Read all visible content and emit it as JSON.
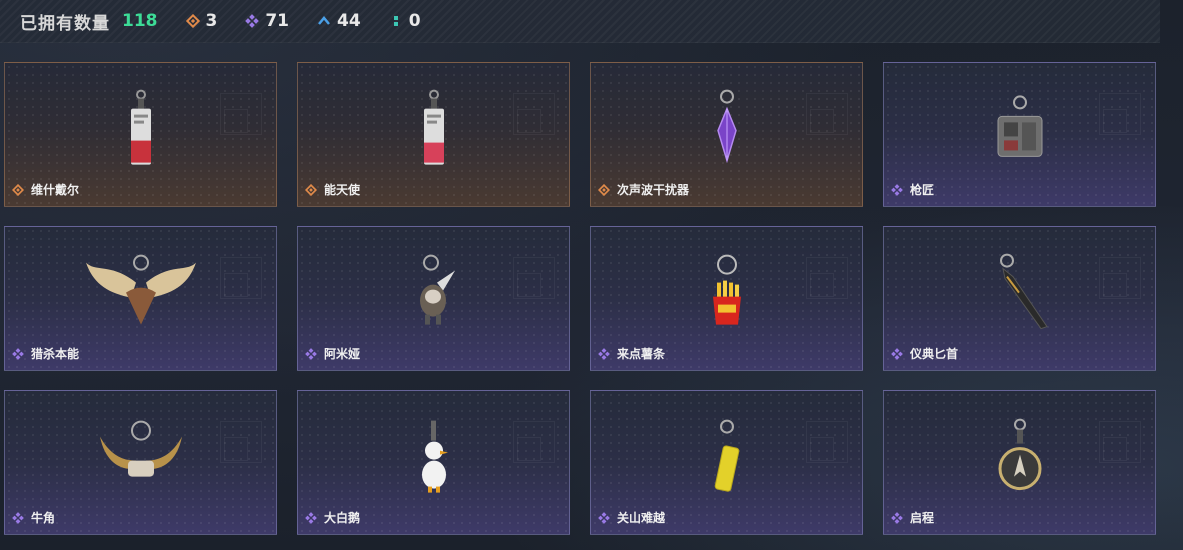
{
  "header": {
    "owned_label": "已拥有数量",
    "owned_count": "118",
    "stats": [
      {
        "icon": "orange-diamond-icon",
        "value": "3",
        "color": "#e08a4a"
      },
      {
        "icon": "purple-diamond-icon",
        "value": "71",
        "color": "#9a7ae6"
      },
      {
        "icon": "blue-chevron-icon",
        "value": "44",
        "color": "#4aa0e8"
      },
      {
        "icon": "teal-dots-icon",
        "value": "0",
        "color": "#3cc7b4"
      }
    ]
  },
  "items": [
    {
      "name": "维什戴尔",
      "rarity": "orange",
      "art": "tag-strap-icon"
    },
    {
      "name": "能天使",
      "rarity": "orange",
      "art": "tag-strap-icon"
    },
    {
      "name": "次声波干扰器",
      "rarity": "orange",
      "art": "purple-crystal-icon"
    },
    {
      "name": "枪匠",
      "rarity": "purple",
      "art": "gear-box-icon"
    },
    {
      "name": "猎杀本能",
      "rarity": "purple",
      "art": "moose-antlers-icon"
    },
    {
      "name": "阿米娅",
      "rarity": "purple",
      "art": "plush-bunny-icon"
    },
    {
      "name": "来点薯条",
      "rarity": "purple",
      "art": "fries-icon"
    },
    {
      "name": "仪典匕首",
      "rarity": "purple",
      "art": "dagger-icon"
    },
    {
      "name": "牛角",
      "rarity": "purple",
      "art": "bull-horns-icon"
    },
    {
      "name": "大白鹅",
      "rarity": "purple",
      "art": "white-goose-icon"
    },
    {
      "name": "关山难越",
      "rarity": "purple",
      "art": "yellow-can-icon"
    },
    {
      "name": "启程",
      "rarity": "purple",
      "art": "compass-medal-icon"
    }
  ],
  "colors": {
    "orange": "#e08a4a",
    "purple": "#9a7ae6",
    "owned_count": "#3ddc97"
  }
}
